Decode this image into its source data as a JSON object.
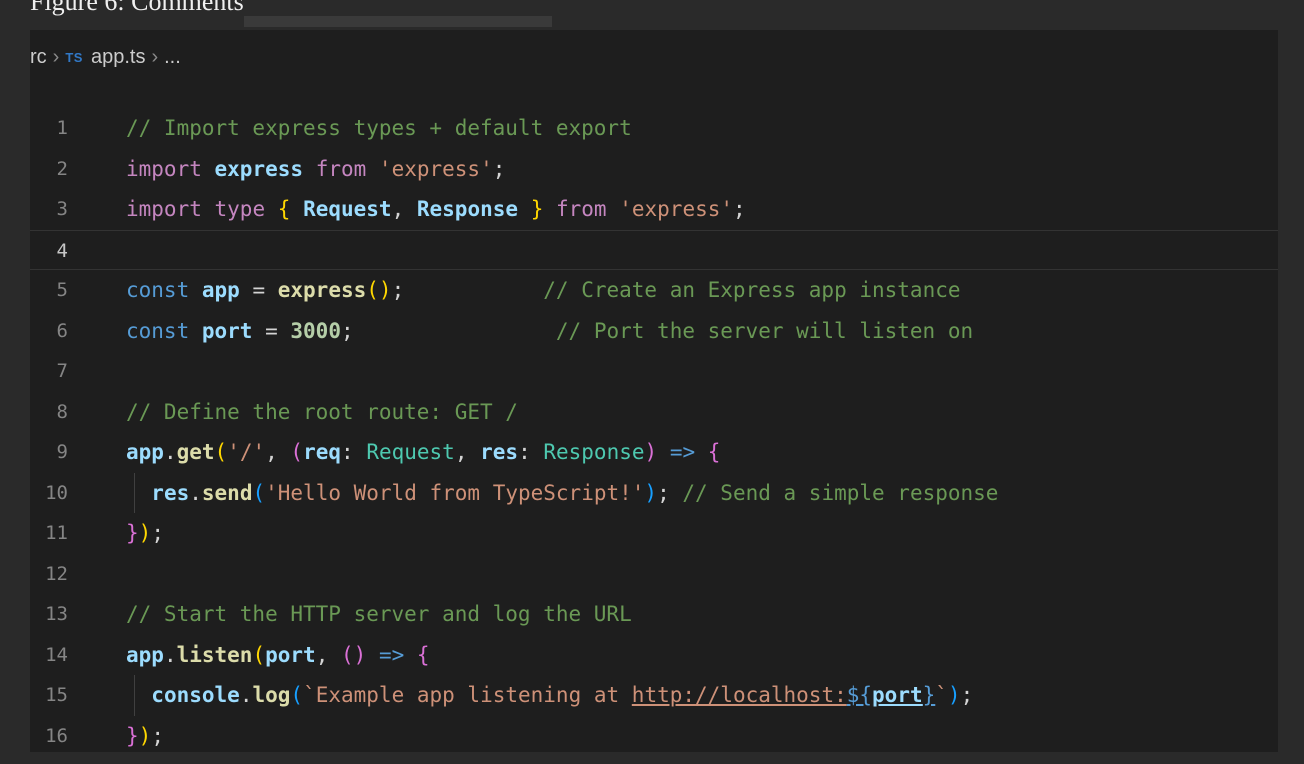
{
  "caption": "Figure 6: Comments",
  "breadcrumb": {
    "folder": "rc",
    "file_badge": "TS",
    "file": "app.ts",
    "more": "..."
  },
  "editor": {
    "line_numbers": [
      "1",
      "2",
      "3",
      "4",
      "5",
      "6",
      "7",
      "8",
      "9",
      "10",
      "11",
      "12",
      "13",
      "14",
      "15",
      "16"
    ],
    "current_line": "4",
    "lines": [
      {
        "tokens": [
          {
            "t": "// Import express types + default export",
            "c": "comment"
          }
        ]
      },
      {
        "tokens": [
          {
            "t": "import",
            "c": "ctrl"
          },
          {
            "t": " ",
            "c": "punc"
          },
          {
            "t": "express",
            "c": "var"
          },
          {
            "t": " ",
            "c": "punc"
          },
          {
            "t": "from",
            "c": "ctrl"
          },
          {
            "t": " ",
            "c": "punc"
          },
          {
            "t": "'express'",
            "c": "str"
          },
          {
            "t": ";",
            "c": "punc"
          }
        ]
      },
      {
        "tokens": [
          {
            "t": "import",
            "c": "ctrl"
          },
          {
            "t": " ",
            "c": "punc"
          },
          {
            "t": "type",
            "c": "ctrl"
          },
          {
            "t": " ",
            "c": "punc"
          },
          {
            "t": "{",
            "c": "b1"
          },
          {
            "t": " ",
            "c": "punc"
          },
          {
            "t": "Request",
            "c": "var"
          },
          {
            "t": ", ",
            "c": "punc"
          },
          {
            "t": "Response",
            "c": "var"
          },
          {
            "t": " ",
            "c": "punc"
          },
          {
            "t": "}",
            "c": "b1"
          },
          {
            "t": " ",
            "c": "punc"
          },
          {
            "t": "from",
            "c": "ctrl"
          },
          {
            "t": " ",
            "c": "punc"
          },
          {
            "t": "'express'",
            "c": "str"
          },
          {
            "t": ";",
            "c": "punc"
          }
        ]
      },
      {
        "tokens": []
      },
      {
        "tokens": [
          {
            "t": "const",
            "c": "kw"
          },
          {
            "t": " ",
            "c": "punc"
          },
          {
            "t": "app",
            "c": "var"
          },
          {
            "t": " = ",
            "c": "punc"
          },
          {
            "t": "express",
            "c": "fn"
          },
          {
            "t": "()",
            "c": "b1"
          },
          {
            "t": ";           ",
            "c": "punc"
          },
          {
            "t": "// Create an Express app instance",
            "c": "comment"
          }
        ]
      },
      {
        "tokens": [
          {
            "t": "const",
            "c": "kw"
          },
          {
            "t": " ",
            "c": "punc"
          },
          {
            "t": "port",
            "c": "var"
          },
          {
            "t": " = ",
            "c": "punc"
          },
          {
            "t": "3000",
            "c": "num"
          },
          {
            "t": ";                ",
            "c": "punc"
          },
          {
            "t": "// Port the server will listen on",
            "c": "comment"
          }
        ]
      },
      {
        "tokens": []
      },
      {
        "tokens": [
          {
            "t": "// Define the root route: GET /",
            "c": "comment"
          }
        ]
      },
      {
        "tokens": [
          {
            "t": "app",
            "c": "var"
          },
          {
            "t": ".",
            "c": "punc"
          },
          {
            "t": "get",
            "c": "fn"
          },
          {
            "t": "(",
            "c": "b1"
          },
          {
            "t": "'/'",
            "c": "str"
          },
          {
            "t": ", ",
            "c": "punc"
          },
          {
            "t": "(",
            "c": "b2"
          },
          {
            "t": "req",
            "c": "var"
          },
          {
            "t": ": ",
            "c": "punc"
          },
          {
            "t": "Request",
            "c": "type"
          },
          {
            "t": ", ",
            "c": "punc"
          },
          {
            "t": "res",
            "c": "var"
          },
          {
            "t": ": ",
            "c": "punc"
          },
          {
            "t": "Response",
            "c": "type"
          },
          {
            "t": ")",
            "c": "b2"
          },
          {
            "t": " ",
            "c": "punc"
          },
          {
            "t": "=>",
            "c": "kw"
          },
          {
            "t": " ",
            "c": "punc"
          },
          {
            "t": "{",
            "c": "b2"
          }
        ]
      },
      {
        "tokens": [
          {
            "t": "  ",
            "c": "punc"
          },
          {
            "t": "res",
            "c": "var"
          },
          {
            "t": ".",
            "c": "punc"
          },
          {
            "t": "send",
            "c": "fn"
          },
          {
            "t": "(",
            "c": "b3"
          },
          {
            "t": "'Hello World from TypeScript!'",
            "c": "str"
          },
          {
            "t": ")",
            "c": "b3"
          },
          {
            "t": "; ",
            "c": "punc"
          },
          {
            "t": "// Send a simple response",
            "c": "comment"
          }
        ],
        "guide": true
      },
      {
        "tokens": [
          {
            "t": "}",
            "c": "b2"
          },
          {
            "t": ")",
            "c": "b1"
          },
          {
            "t": ";",
            "c": "punc"
          }
        ]
      },
      {
        "tokens": []
      },
      {
        "tokens": [
          {
            "t": "// Start the HTTP server and log the URL",
            "c": "comment"
          }
        ]
      },
      {
        "tokens": [
          {
            "t": "app",
            "c": "var"
          },
          {
            "t": ".",
            "c": "punc"
          },
          {
            "t": "listen",
            "c": "fn"
          },
          {
            "t": "(",
            "c": "b1"
          },
          {
            "t": "port",
            "c": "var"
          },
          {
            "t": ", ",
            "c": "punc"
          },
          {
            "t": "()",
            "c": "b2"
          },
          {
            "t": " ",
            "c": "punc"
          },
          {
            "t": "=>",
            "c": "kw"
          },
          {
            "t": " ",
            "c": "punc"
          },
          {
            "t": "{",
            "c": "b2"
          }
        ]
      },
      {
        "tokens": [
          {
            "t": "  ",
            "c": "punc"
          },
          {
            "t": "console",
            "c": "var"
          },
          {
            "t": ".",
            "c": "punc"
          },
          {
            "t": "log",
            "c": "fn"
          },
          {
            "t": "(",
            "c": "b3"
          },
          {
            "t": "`Example app listening at ",
            "c": "str"
          },
          {
            "t": "http://localhost:",
            "c": "str link"
          },
          {
            "t": "${",
            "c": "kw link"
          },
          {
            "t": "port",
            "c": "var link"
          },
          {
            "t": "}",
            "c": "kw link"
          },
          {
            "t": "`",
            "c": "str"
          },
          {
            "t": ")",
            "c": "b3"
          },
          {
            "t": ";",
            "c": "punc"
          }
        ],
        "guide": true
      },
      {
        "tokens": [
          {
            "t": "}",
            "c": "b2"
          },
          {
            "t": ")",
            "c": "b1"
          },
          {
            "t": ";",
            "c": "punc"
          }
        ]
      }
    ]
  },
  "colors": {
    "background": "#2a2a2a",
    "editor_bg": "#1e1e1e",
    "comment": "#6a9955",
    "keyword": "#569cd6",
    "control": "#c586c0",
    "variable": "#9cdcfe",
    "function": "#dcdcaa",
    "string": "#ce9178",
    "number": "#b5cea8",
    "type": "#4ec9b0",
    "ts_badge": "#3178c6"
  }
}
